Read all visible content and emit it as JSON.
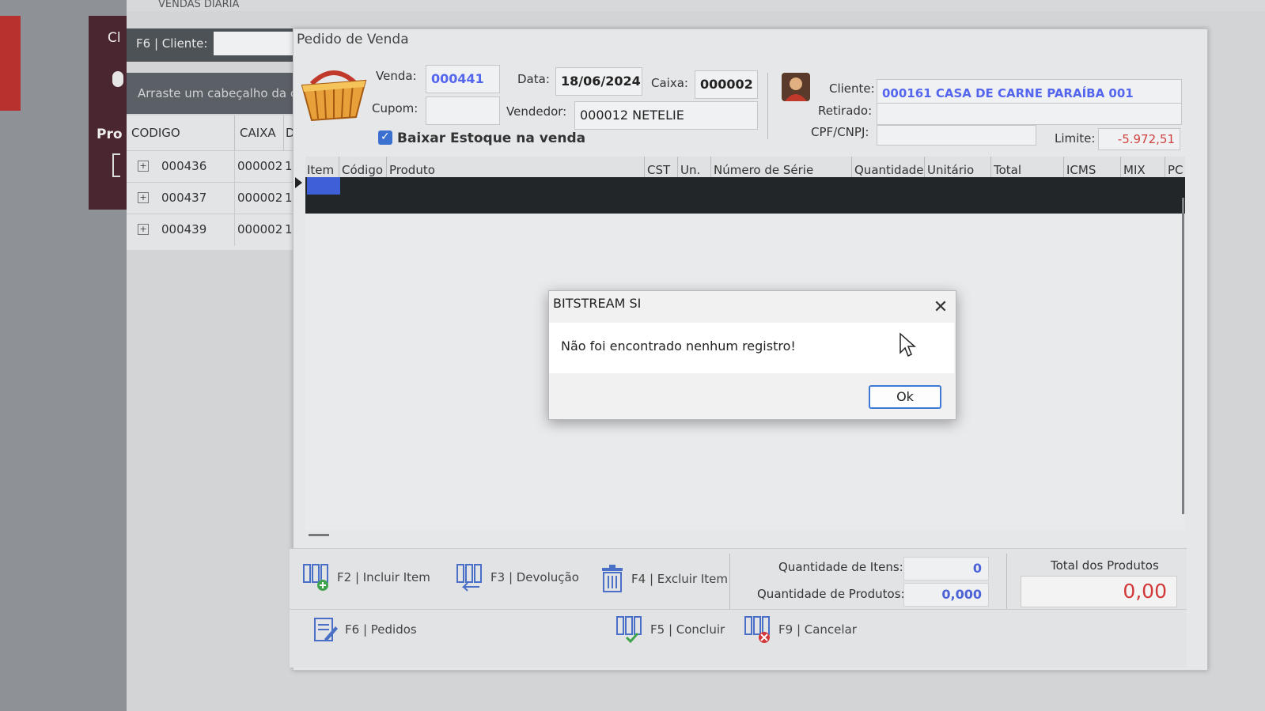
{
  "background_window": {
    "title": "VENDAS DIÁRIA",
    "left_panel": {
      "short_label_top": "Cl",
      "short_label_mid": "Pro"
    },
    "client_filter": {
      "label": "F6 | Cliente:",
      "value": ""
    },
    "group_hint": "Arraste um cabeçalho da c",
    "columns": [
      "CODIGO",
      "CAIXA",
      "D"
    ],
    "rows": [
      {
        "expand": "+",
        "codigo": "000436",
        "caixa": "000002",
        "d": "1"
      },
      {
        "expand": "+",
        "codigo": "000437",
        "caixa": "000002",
        "d": "1"
      },
      {
        "expand": "+",
        "codigo": "000439",
        "caixa": "000002",
        "d": "1"
      }
    ]
  },
  "pedido": {
    "title": "Pedido de Venda",
    "venda": {
      "label": "Venda:",
      "value": "000441"
    },
    "data": {
      "label": "Data:",
      "value": "18/06/2024"
    },
    "caixa": {
      "label": "Caixa:",
      "value": "000002"
    },
    "cupom": {
      "label": "Cupom:",
      "value": ""
    },
    "vendedor": {
      "label": "Vendedor:",
      "value": "000012  NETELIE"
    },
    "baixar_estoque": {
      "label": "Baixar Estoque na venda",
      "checked": true
    },
    "cliente": {
      "label": "Cliente:",
      "value": "000161   CASA DE CARNE PARAÍBA 001"
    },
    "retirado": {
      "label": "Retirado:",
      "value": ""
    },
    "cpf_cnpj": {
      "label": "CPF/CNPJ:",
      "value": ""
    },
    "limite": {
      "label": "Limite:",
      "value": "-5.972,51"
    },
    "grid_columns": [
      "Item",
      "Código",
      "Produto",
      "CST",
      "Un.",
      "Número de Série",
      "Quantidade",
      "Unitário",
      "Total",
      "ICMS",
      "MIX",
      "PC"
    ]
  },
  "toolbar": {
    "f2": "F2 | Incluir Item",
    "f3": "F3 | Devolução",
    "f4": "F4 | Excluir Item",
    "f6": "F6 | Pedidos",
    "f5": "F5 | Concluir",
    "f9": "F9 | Cancelar"
  },
  "summary": {
    "qtd_itens_label": "Quantidade de Itens:",
    "qtd_itens_value": "0",
    "qtd_produtos_label": "Quantidade de Produtos:",
    "qtd_produtos_value": "0,000",
    "total_label": "Total dos Produtos",
    "total_value": "0,00"
  },
  "alert": {
    "title": "BITSTREAM SI",
    "message": "Não foi encontrado nenhum registro!",
    "ok_label": "Ok"
  },
  "colors": {
    "accent_blue": "#3c7ad6",
    "value_blue": "#5566ee",
    "negative_red": "#d04040",
    "selection_blue": "#3f5fd8"
  },
  "icons": [
    "basket-icon",
    "user-avatar-icon",
    "add-item-icon",
    "return-icon",
    "trash-icon",
    "orders-icon",
    "conclude-icon",
    "cancel-icon",
    "close-icon",
    "mouse-cursor-icon"
  ]
}
